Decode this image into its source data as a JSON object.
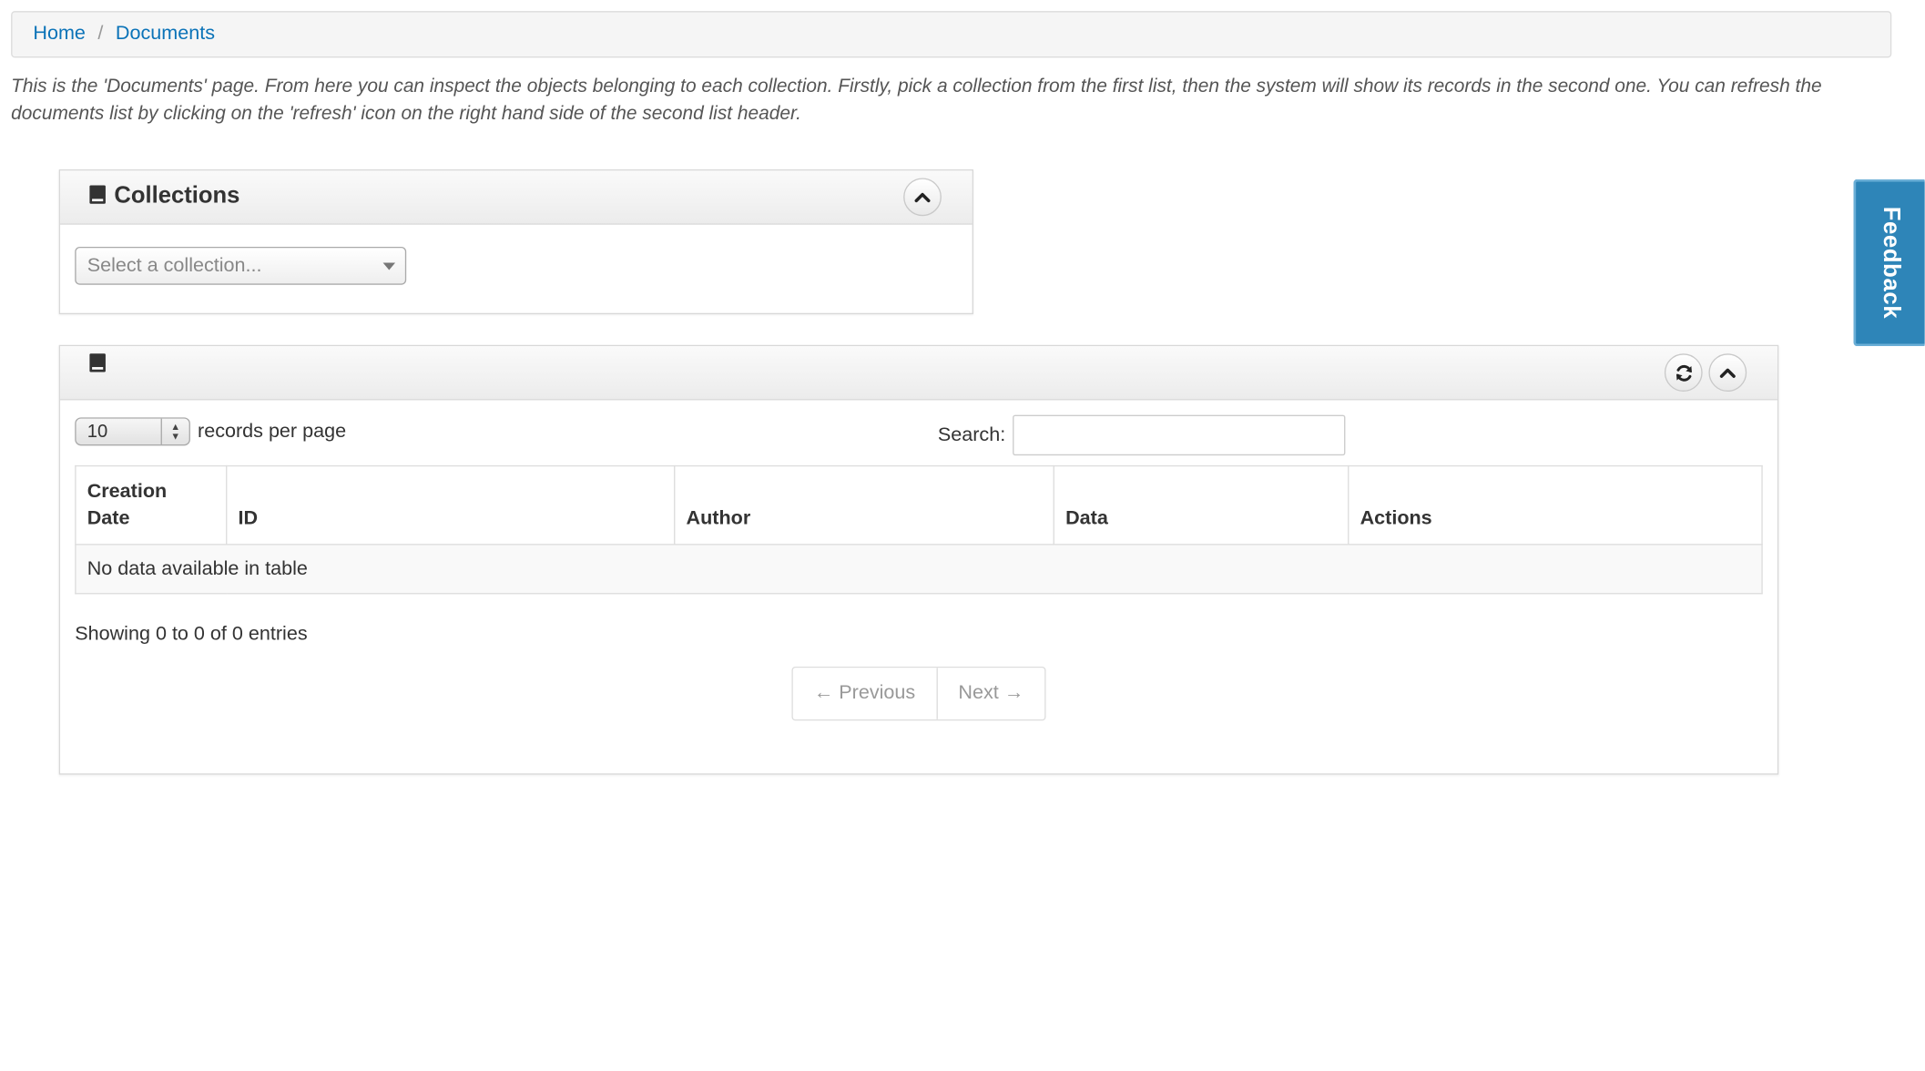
{
  "breadcrumb": {
    "home": "Home",
    "separator": "/",
    "current": "Documents"
  },
  "intro_text": "This is the 'Documents' page. From here you can inspect the objects belonging to each collection. Firstly, pick a collection from the first list, then the system will show its records in the second one. You can refresh the documents list by clicking on the 'refresh' icon on the right hand side of the second list header.",
  "collections_panel": {
    "title": "Collections",
    "icon": "book-icon",
    "collapse_icon": "chevron-up-icon",
    "select_placeholder": "Select a collection..."
  },
  "records_panel": {
    "title": "",
    "icon": "book-icon",
    "refresh_icon": "refresh-icon",
    "collapse_icon": "chevron-up-icon",
    "page_size": "10",
    "page_size_label": "records per page",
    "search_label": "Search:",
    "search_value": "",
    "columns": [
      "Creation Date",
      "ID",
      "Author",
      "Data",
      "Actions"
    ],
    "empty_message": "No data available in table",
    "info": "Showing 0 to 0 of 0 entries",
    "prev_label": "← Previous",
    "next_label": "Next →"
  },
  "feedback": {
    "label": "Feedback",
    "color": "#2e85b8"
  },
  "colors": {
    "link": "#0b73b8"
  }
}
